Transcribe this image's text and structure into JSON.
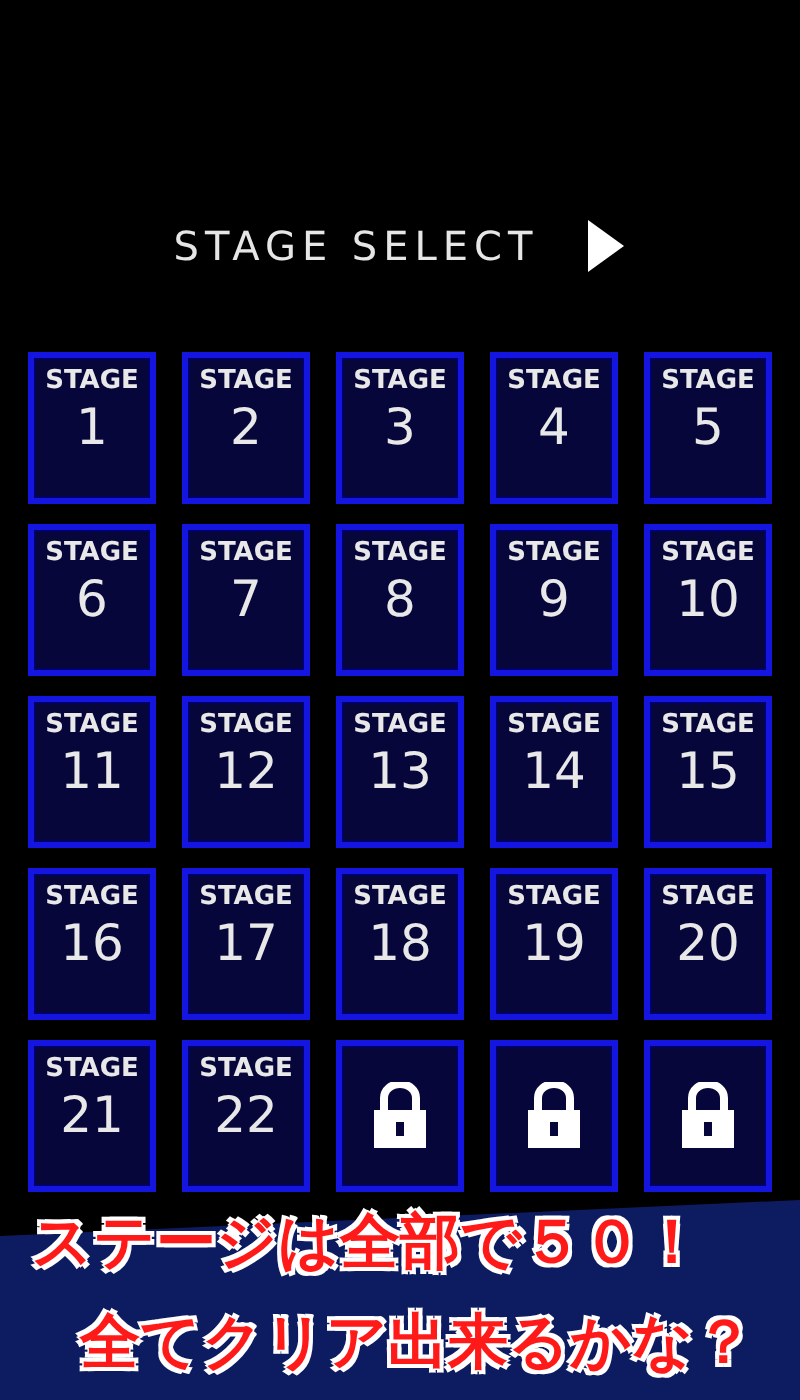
{
  "title": "STAGE SELECT",
  "stages": [
    {
      "kind": "stage",
      "label": "STAGE",
      "number": "1"
    },
    {
      "kind": "stage",
      "label": "STAGE",
      "number": "2"
    },
    {
      "kind": "stage",
      "label": "STAGE",
      "number": "3"
    },
    {
      "kind": "stage",
      "label": "STAGE",
      "number": "4"
    },
    {
      "kind": "stage",
      "label": "STAGE",
      "number": "5"
    },
    {
      "kind": "stage",
      "label": "STAGE",
      "number": "6"
    },
    {
      "kind": "stage",
      "label": "STAGE",
      "number": "7"
    },
    {
      "kind": "stage",
      "label": "STAGE",
      "number": "8"
    },
    {
      "kind": "stage",
      "label": "STAGE",
      "number": "9"
    },
    {
      "kind": "stage",
      "label": "STAGE",
      "number": "10"
    },
    {
      "kind": "stage",
      "label": "STAGE",
      "number": "11"
    },
    {
      "kind": "stage",
      "label": "STAGE",
      "number": "12"
    },
    {
      "kind": "stage",
      "label": "STAGE",
      "number": "13"
    },
    {
      "kind": "stage",
      "label": "STAGE",
      "number": "14"
    },
    {
      "kind": "stage",
      "label": "STAGE",
      "number": "15"
    },
    {
      "kind": "stage",
      "label": "STAGE",
      "number": "16"
    },
    {
      "kind": "stage",
      "label": "STAGE",
      "number": "17"
    },
    {
      "kind": "stage",
      "label": "STAGE",
      "number": "18"
    },
    {
      "kind": "stage",
      "label": "STAGE",
      "number": "19"
    },
    {
      "kind": "stage",
      "label": "STAGE",
      "number": "20"
    },
    {
      "kind": "stage",
      "label": "STAGE",
      "number": "21"
    },
    {
      "kind": "stage",
      "label": "STAGE",
      "number": "22"
    },
    {
      "kind": "locked"
    },
    {
      "kind": "locked"
    },
    {
      "kind": "locked"
    }
  ],
  "banner": [
    "ステージは全部で５０！",
    "全てクリア出来るかな？"
  ]
}
